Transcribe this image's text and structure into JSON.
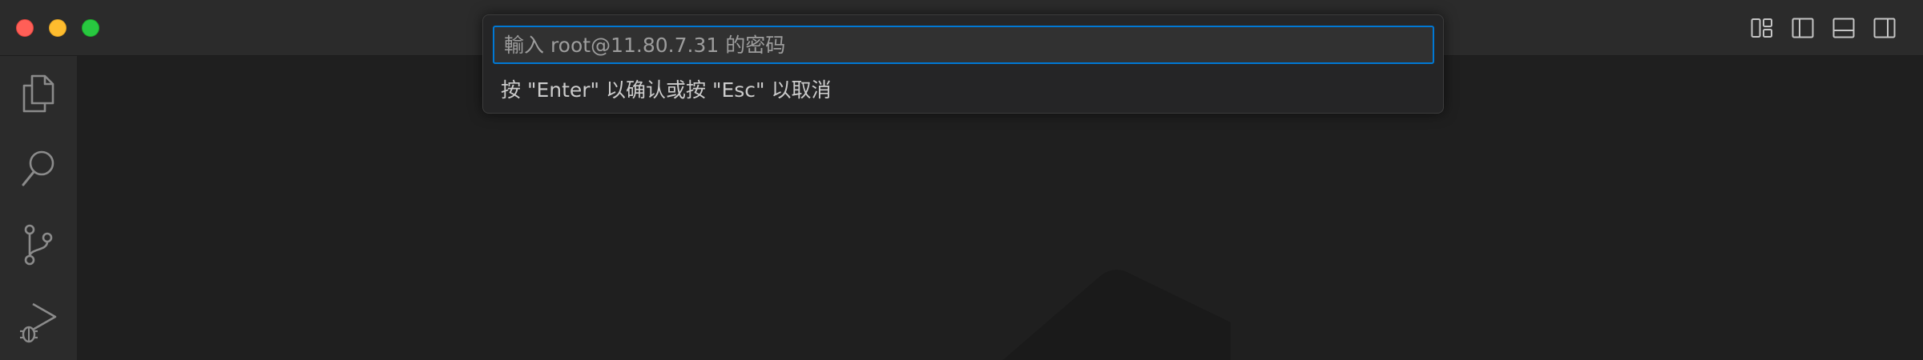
{
  "window": {
    "traffic_lights": {
      "close_color": "#ff5f57",
      "minimize_color": "#febc2e",
      "maximize_color": "#28c840"
    },
    "layout_controls": [
      {
        "name": "customize-layout-icon"
      },
      {
        "name": "toggle-primary-sidebar-icon"
      },
      {
        "name": "toggle-panel-icon"
      },
      {
        "name": "toggle-secondary-sidebar-icon"
      }
    ]
  },
  "activity_bar": {
    "items": [
      {
        "icon": "explorer-icon"
      },
      {
        "icon": "search-icon"
      },
      {
        "icon": "source-control-icon"
      },
      {
        "icon": "run-debug-icon"
      }
    ]
  },
  "quick_input": {
    "placeholder": "輸入 root@11.80.7.31 的密码",
    "value": "",
    "message": "按 \"Enter\" 以确认或按 \"Esc\" 以取消",
    "accent_color": "#0078d4"
  }
}
